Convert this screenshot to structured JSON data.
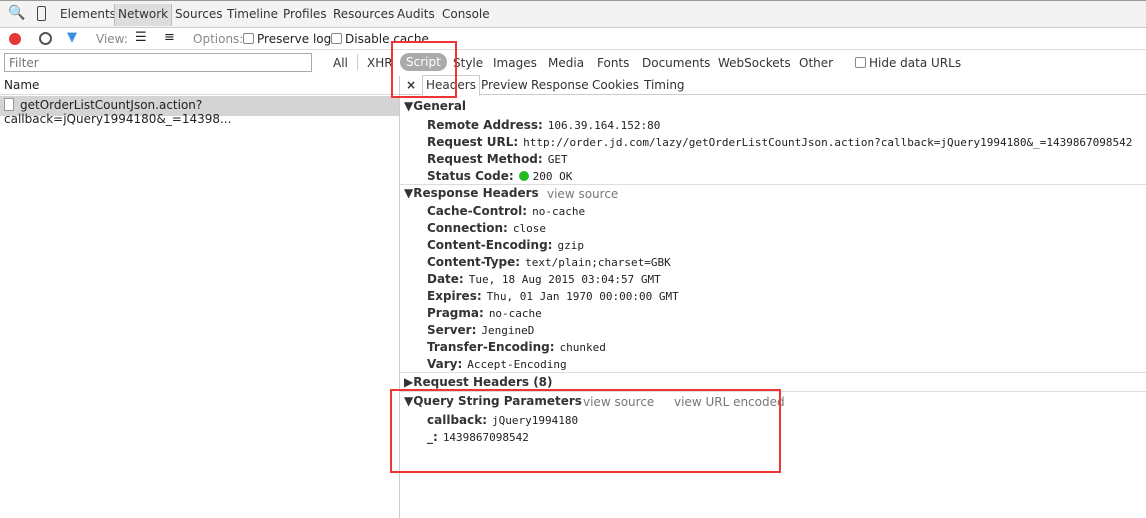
{
  "panel_tabs": [
    "Elements",
    "Network",
    "Sources",
    "Timeline",
    "Profiles",
    "Resources",
    "Audits",
    "Console"
  ],
  "active_panel": "Network",
  "toolbar": {
    "view_label": "View:",
    "options_label": "Options:",
    "preserve_log": "Preserve log",
    "disable_cache": "Disable cache",
    "record_color": "#e53935"
  },
  "filter": {
    "placeholder": "Filter",
    "types": [
      "All",
      "XHR",
      "Script",
      "Style",
      "Images",
      "Media",
      "Fonts",
      "Documents",
      "WebSockets",
      "Other"
    ],
    "selected": "Script",
    "hide_data_urls": "Hide data URLs"
  },
  "list": {
    "header": "Name",
    "requests": [
      "getOrderListCountJson.action?callback=jQuery1994180&_=14398..."
    ]
  },
  "detail_tabs": [
    "Headers",
    "Preview",
    "Response",
    "Cookies",
    "Timing"
  ],
  "active_detail_tab": "Headers",
  "general": {
    "title": "General",
    "items": [
      {
        "k": "Remote Address:",
        "v": "106.39.164.152:80"
      },
      {
        "k": "Request URL:",
        "v": "http://order.jd.com/lazy/getOrderListCountJson.action?callback=jQuery1994180&_=1439867098542"
      },
      {
        "k": "Request Method:",
        "v": "GET"
      },
      {
        "k": "Status Code:",
        "v": "200 OK"
      }
    ]
  },
  "response_headers": {
    "title": "Response Headers",
    "view_source": "view source",
    "items": [
      {
        "k": "Cache-Control:",
        "v": "no-cache"
      },
      {
        "k": "Connection:",
        "v": "close"
      },
      {
        "k": "Content-Encoding:",
        "v": "gzip"
      },
      {
        "k": "Content-Type:",
        "v": "text/plain;charset=GBK"
      },
      {
        "k": "Date:",
        "v": "Tue, 18 Aug 2015 03:04:57 GMT"
      },
      {
        "k": "Expires:",
        "v": "Thu, 01 Jan 1970 00:00:00 GMT"
      },
      {
        "k": "Pragma:",
        "v": "no-cache"
      },
      {
        "k": "Server:",
        "v": "JengineD"
      },
      {
        "k": "Transfer-Encoding:",
        "v": "chunked"
      },
      {
        "k": "Vary:",
        "v": "Accept-Encoding"
      }
    ]
  },
  "request_headers": {
    "title": "Request Headers (8)"
  },
  "query_params": {
    "title": "Query String Parameters",
    "view_source": "view source",
    "view_url_encoded": "view URL encoded",
    "items": [
      {
        "k": "callback:",
        "v": "jQuery1994180"
      },
      {
        "k": "_:",
        "v": "1439867098542"
      }
    ]
  }
}
